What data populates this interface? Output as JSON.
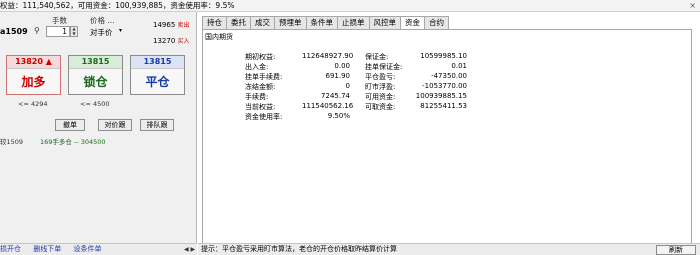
{
  "topbar": {
    "text": "权益：111,540,562，可用资金：100,939,885，资金使用率：9.5%",
    "close": "×"
  },
  "order": {
    "contract_label": "",
    "contract": "a1509",
    "qty_label": "手数",
    "qty": "1",
    "price_label": "价格 ...",
    "price_value": "对手价",
    "ask_price": "14965",
    "ask_tag": "卖出",
    "bid_price": "13270",
    "bid_tag": "买入"
  },
  "buttons": {
    "buy": {
      "price": "13820 ▲",
      "label": "加多",
      "limit": "<= 4294"
    },
    "sell": {
      "price": "13815",
      "label": "锁仓",
      "limit": "<= 4500"
    },
    "close": {
      "price": "13815",
      "label": "平仓"
    },
    "small": [
      "撤单",
      "对价跟",
      "排队跟"
    ]
  },
  "position": {
    "contract": "较1509",
    "text": "169手多仓 -- 304500"
  },
  "left_bottom": [
    "损开仓",
    "删线下单",
    "设条件单"
  ],
  "tabs": [
    "持仓",
    "委托",
    "成交",
    "预埋单",
    "条件单",
    "止损单",
    "风控单",
    "资金",
    "合约"
  ],
  "active_tab": "资金",
  "funds": {
    "group": "国内期货",
    "rows_left": [
      {
        "label": "期初权益:",
        "value": "112648927.90"
      },
      {
        "label": "出入金:",
        "value": "0.00"
      },
      {
        "label": "挂单手续费:",
        "value": "691.90"
      },
      {
        "label": "冻结金额:",
        "value": "0"
      },
      {
        "label": "手续费:",
        "value": "7245.74"
      },
      {
        "label": "当前权益:",
        "value": "111540562.16"
      },
      {
        "label": "资金使用率:",
        "value": "9.50%"
      }
    ],
    "rows_right": [
      {
        "label": "保证金:",
        "value": "10599985.10"
      },
      {
        "label": "挂单保证金:",
        "value": "0.01"
      },
      {
        "label": "平仓盈亏:",
        "value": "-47350.00"
      },
      {
        "label": "盯市浮盈:",
        "value": "-1053770.00"
      },
      {
        "label": "可用资金:",
        "value": "100939885.15"
      },
      {
        "label": "可取资金:",
        "value": "81255411.53"
      }
    ]
  },
  "status_text": "提示：平仓盈亏采用盯市算法，老仓的开仓价格取昨结算价计算",
  "refresh": "刷新",
  "arrows": "◀ ▶"
}
